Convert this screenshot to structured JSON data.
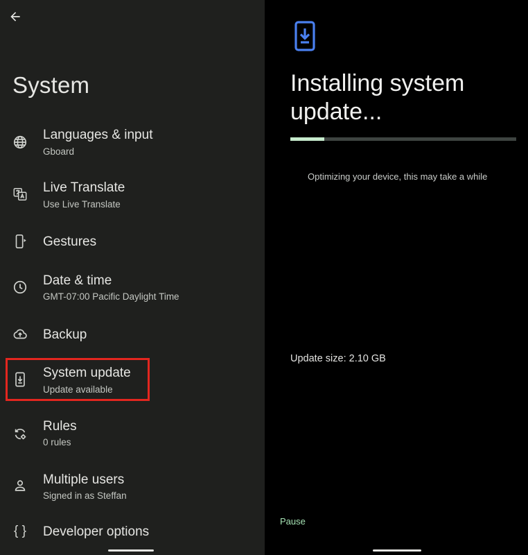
{
  "left": {
    "header": {
      "title": "System",
      "back_icon": "arrow-back-icon"
    },
    "items": [
      {
        "icon": "globe-icon",
        "title": "Languages & input",
        "subtitle": "Gboard"
      },
      {
        "icon": "live-translate-icon",
        "title": "Live Translate",
        "subtitle": "Use Live Translate"
      },
      {
        "icon": "gestures-phone-icon",
        "title": "Gestures",
        "subtitle": ""
      },
      {
        "icon": "clock-icon",
        "title": "Date & time",
        "subtitle": "GMT-07:00 Pacific Daylight Time"
      },
      {
        "icon": "cloud-upload-icon",
        "title": "Backup",
        "subtitle": ""
      },
      {
        "icon": "system-update-icon",
        "title": "System update",
        "subtitle": "Update available"
      },
      {
        "icon": "rules-icon",
        "title": "Rules",
        "subtitle": "0 rules"
      },
      {
        "icon": "person-icon",
        "title": "Multiple users",
        "subtitle": "Signed in as Steffan"
      },
      {
        "icon": "braces-icon",
        "icon_text": "{ }",
        "title": "Developer options",
        "subtitle": ""
      }
    ],
    "highlighted_item": "System update",
    "highlight_color": "#e3261f"
  },
  "right": {
    "icon": "system-update-icon",
    "title": "Installing system update...",
    "progress": 0.15,
    "status": "Optimizing your device, this may take a while",
    "size_text": "Update size: 2.10 GB",
    "pause_label": "Pause",
    "accent_color": "#a6e3b4",
    "icon_color": "#4a80f0"
  },
  "colors": {
    "left_bg": "#1f201e",
    "right_bg": "#000000",
    "progress_fill": "#c6ebcd",
    "progress_track": "#3e4441"
  }
}
